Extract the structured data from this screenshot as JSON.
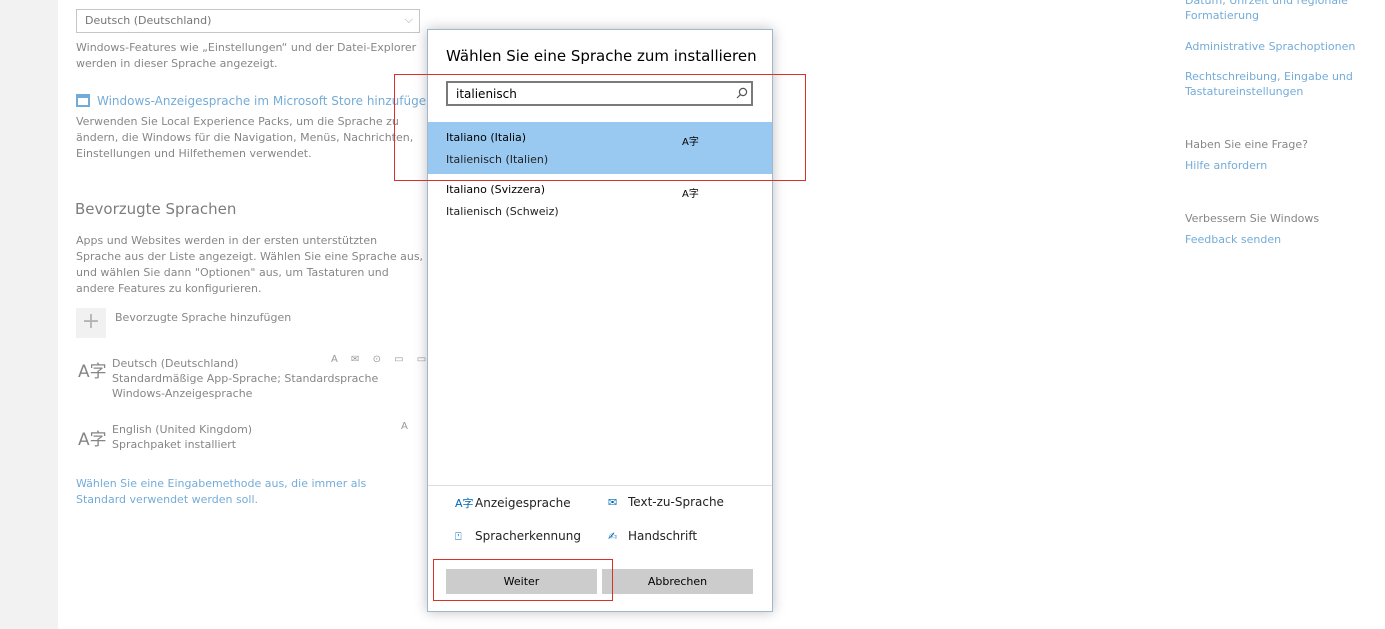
{
  "settings": {
    "display_language_value": "Deutsch (Deutschland)",
    "display_language_desc": "Windows-Features wie „Einstellungen“ und der Datei-Explorer werden in dieser Sprache angezeigt.",
    "store_link": "Windows-Anzeigesprache im Microsoft Store hinzufügen",
    "store_desc": "Verwenden Sie Local Experience Packs, um die Sprache zu ändern, die Windows für die Navigation, Menüs, Nachrichten, Einstellungen und Hilfethemen verwendet.",
    "preferred_heading": "Bevorzugte Sprachen",
    "preferred_desc": "Apps und Websites werden in der ersten unterstützten Sprache aus der Liste angezeigt. Wählen Sie eine Sprache aus, und wählen Sie dann \"Optionen\" aus, um Tastaturen und andere Features zu konfigurieren.",
    "add_language_label": "Bevorzugte Sprache hinzufügen",
    "languages": [
      {
        "name": "Deutsch (Deutschland)",
        "line1": "Standardmäßige App-Sprache; Standardsprache",
        "line2": "Windows-Anzeigesprache"
      },
      {
        "name": "English (United Kingdom)",
        "line1": "Sprachpaket installiert",
        "line2": ""
      }
    ],
    "input_method_link": "Wählen Sie eine Eingabemethode aus, die immer als Standard verwendet werden soll."
  },
  "related": {
    "link_date": "Datum, Uhrzeit und regionale Formatierung",
    "link_admin": "Administrative Sprachoptionen",
    "link_spelling": "Rechtschreibung, Eingabe und Tastatureinstellungen",
    "question_heading": "Haben Sie eine Frage?",
    "help_link": "Hilfe anfordern",
    "improve_heading": "Verbessern Sie Windows",
    "feedback_link": "Feedback senden"
  },
  "dialog": {
    "title": "Wählen Sie eine Sprache zum installieren",
    "search_value": "italienisch",
    "results": [
      {
        "name": "Italiano (Italia)",
        "sub": "Italienisch (Italien)",
        "selected": true
      },
      {
        "name": "Italiano (Svizzera)",
        "sub": "Italienisch (Schweiz)",
        "selected": false
      }
    ],
    "features": {
      "display": "Anzeigesprache",
      "tts": "Text-zu-Sprache",
      "speech": "Spracherkennung",
      "handwriting": "Handschrift"
    },
    "next_label": "Weiter",
    "cancel_label": "Abbrechen"
  },
  "colors": {
    "accent": "#0067b8",
    "selection": "#99c9f0",
    "highlight": "#d9302c"
  }
}
